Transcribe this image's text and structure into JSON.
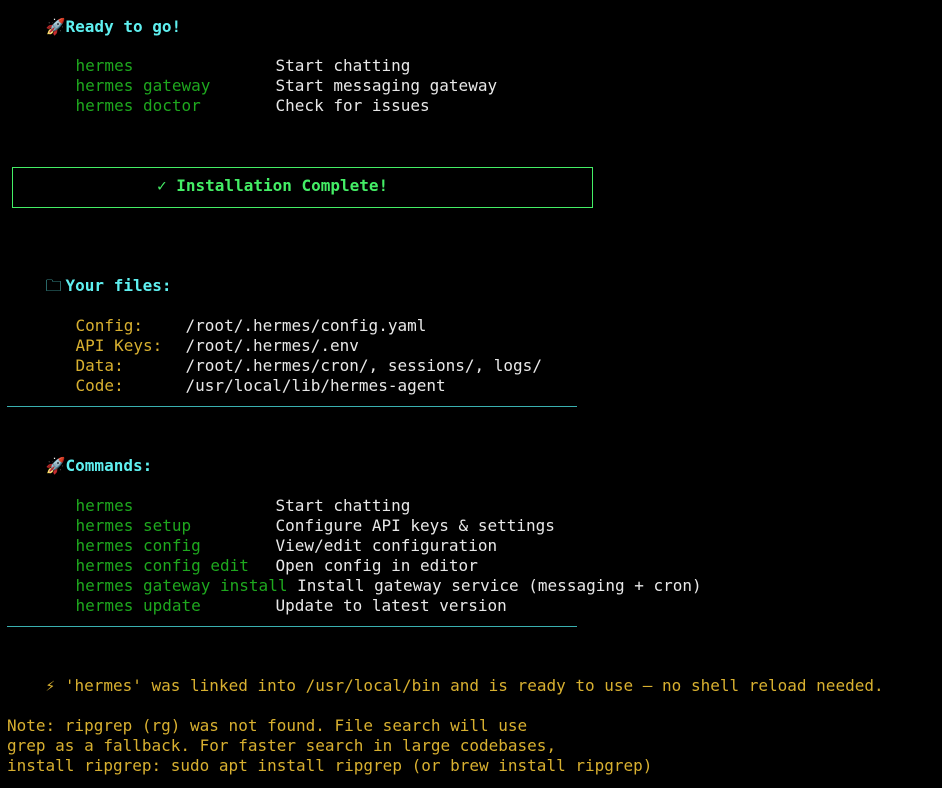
{
  "ready": {
    "icon": "rocket-icon",
    "glyph": "🚀",
    "title": "Ready to go!"
  },
  "quick_commands": [
    {
      "cmd": "hermes",
      "desc": "Start chatting"
    },
    {
      "cmd": "hermes gateway",
      "desc": "Start messaging gateway"
    },
    {
      "cmd": "hermes doctor",
      "desc": "Check for issues"
    }
  ],
  "install_box": {
    "text": "✓ Installation Complete!"
  },
  "files": {
    "icon": "folder-icon",
    "glyph": "🗀",
    "title": "Your files:",
    "items": [
      {
        "label": "Config:",
        "value": "/root/.hermes/config.yaml"
      },
      {
        "label": "API Keys:",
        "value": "/root/.hermes/.env"
      },
      {
        "label": "Data:",
        "value": "/root/.hermes/cron/, sessions/, logs/"
      },
      {
        "label": "Code:",
        "value": "/usr/local/lib/hermes-agent"
      }
    ]
  },
  "commands": {
    "icon": "rocket-icon",
    "glyph": "🚀",
    "title": "Commands:",
    "items": [
      {
        "cmd": "hermes",
        "desc": "Start chatting"
      },
      {
        "cmd": "hermes setup",
        "desc": "Configure API keys & settings"
      },
      {
        "cmd": "hermes config",
        "desc": "View/edit configuration"
      },
      {
        "cmd": "hermes config edit",
        "desc": "Open config in editor"
      },
      {
        "cmd": "hermes gateway install",
        "desc": "Install gateway service (messaging + cron)"
      },
      {
        "cmd": "hermes update",
        "desc": "Update to latest version"
      }
    ]
  },
  "linked": {
    "glyph": "⚡",
    "text": "'hermes' was linked into /usr/local/bin and is ready to use — no shell reload needed."
  },
  "note": {
    "lines": [
      "Note: ripgrep (rg) was not found. File search will use",
      "grep as a fallback. For faster search in large codebases,",
      "install ripgrep: sudo apt install ripgrep (or brew install ripgrep)"
    ]
  },
  "colors": {
    "background": "#000000",
    "cyan": "#5ff0f0",
    "green_dim": "#1ea81e",
    "green_bright": "#44ee66",
    "yellow": "#d8b030",
    "rule": "#3ab0b0"
  }
}
